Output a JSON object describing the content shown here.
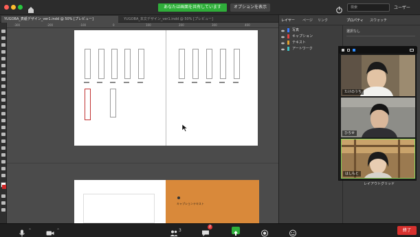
{
  "topbar": {
    "share_banner": "あなたは画面を共有しています",
    "view_options": "オプションを表示",
    "search_placeholder": "検索",
    "account_label": "ユーザー"
  },
  "tabs": [
    {
      "label": "YUGOBA_表紙デザイン_ver1.indd @ 50% [プレビュー]",
      "active": true
    },
    {
      "label": "YUGOBA_本文デザイン_ver1.indd @ 50% [プレビュー]",
      "active": false
    }
  ],
  "ruler_ticks": [
    "-300",
    "-200",
    "-100",
    "0",
    "100",
    "200",
    "300",
    "400"
  ],
  "panel": {
    "tabs": [
      "レイヤー",
      "ページ",
      "リンク"
    ],
    "right_tabs": [
      "プロパティ",
      "スウォッチ"
    ],
    "layers": [
      {
        "name": "写真",
        "color": "#3a7bff"
      },
      {
        "name": "キャプション",
        "color": "#e04040"
      },
      {
        "name": "テキスト",
        "color": "#e0a030"
      },
      {
        "name": "アートワーク",
        "color": "#40c0c0"
      }
    ],
    "props_label": "選択なし",
    "footer": "レイアウトグリッド"
  },
  "participants": [
    {
      "name": "たけのうち",
      "bg": "#7a6b55",
      "face": "#e2c3a4",
      "hair": "#1a1a1a"
    },
    {
      "name": "ひろせ",
      "bg": "#8d8d88",
      "face": "#d9b79a",
      "hair": "#151515"
    },
    {
      "name": "はしもと",
      "bg": "#9b7a50",
      "face": "#e8cdb2",
      "hair": "#1b1b1b"
    }
  ],
  "bottombar": {
    "participants_count": "3",
    "chat_badge": "2",
    "end_label": "終了"
  },
  "caption_text": "キャプションテキスト",
  "colors": {
    "accent_green": "#2fae3a",
    "end_red": "#d8312e",
    "orange_page": "#d9893a"
  }
}
